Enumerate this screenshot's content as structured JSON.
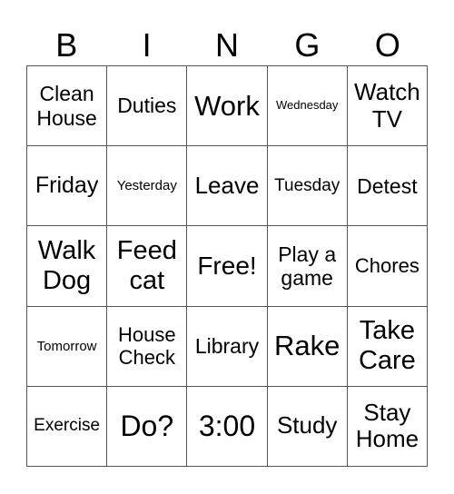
{
  "header": [
    "B",
    "I",
    "N",
    "G",
    "O"
  ],
  "cells": [
    [
      "Clean House",
      "Duties",
      "Work",
      "Wednesday",
      "Watch TV"
    ],
    [
      "Friday",
      "Yesterday",
      "Leave",
      "Tuesday",
      "Detest"
    ],
    [
      "Walk Dog",
      "Feed cat",
      "Free!",
      "Play a game",
      "Chores"
    ],
    [
      "Tomorrow",
      "House Check",
      "Library",
      "Rake",
      "Take Care"
    ],
    [
      "Exercise",
      "Do?",
      "3:00",
      "Study",
      "Stay Home"
    ]
  ]
}
